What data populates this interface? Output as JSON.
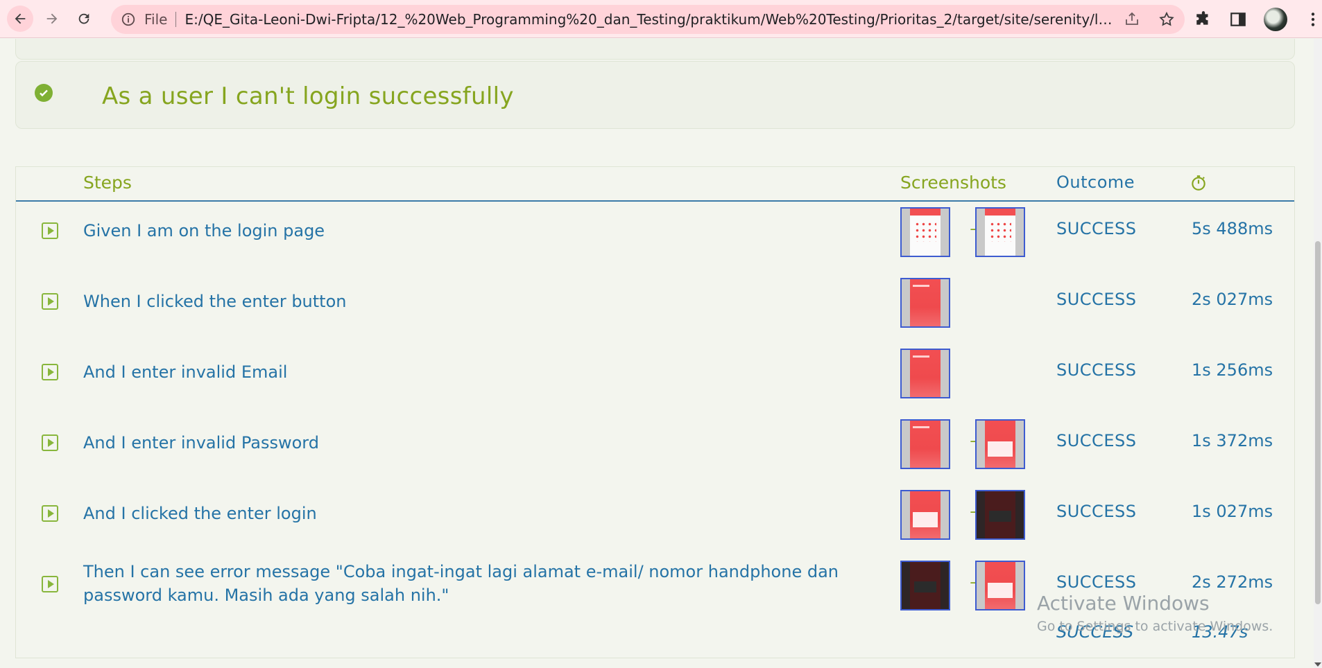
{
  "browser": {
    "file_label": "File",
    "url": "E:/QE_Gita-Leoni-Dwi-Fripta/12_%20Web_Programming%20_dan_Testing/praktikum/Web%20Testing/Prioritas_2/target/site/serenity/login_sep...",
    "accent_color": "#ffe9ec"
  },
  "scenario": {
    "title": "As a user I can't login successfully",
    "status_color": "#7fb034"
  },
  "table": {
    "headers": {
      "steps": "Steps",
      "screenshots": "Screenshots",
      "outcome": "Outcome"
    },
    "rows": [
      {
        "step": "Given I am on the login page",
        "outcome": "SUCCESS",
        "duration": "5s 488ms"
      },
      {
        "step": "When I clicked the enter button",
        "outcome": "SUCCESS",
        "duration": "2s 027ms"
      },
      {
        "step": "And I enter invalid Email",
        "outcome": "SUCCESS",
        "duration": "1s 256ms"
      },
      {
        "step": "And I enter invalid Password",
        "outcome": "SUCCESS",
        "duration": "1s 372ms"
      },
      {
        "step": "And I clicked the enter login",
        "outcome": "SUCCESS",
        "duration": "1s 027ms"
      },
      {
        "step": "Then I can see error message \"Coba ingat-ingat lagi alamat e-mail/ nomor handphone dan password kamu. Masih ada yang salah nih.\"",
        "outcome": "SUCCESS",
        "duration": "2s 272ms"
      }
    ],
    "arrow": "→",
    "total": {
      "outcome": "SUCCESS",
      "duration": "13.47s"
    }
  },
  "watermark": {
    "title": "Activate Windows",
    "subtitle": "Go to Settings to activate Windows."
  },
  "colors": {
    "heading_green": "#86a51f",
    "link_blue": "#2573a6",
    "divider_blue": "#3b7aa8"
  }
}
